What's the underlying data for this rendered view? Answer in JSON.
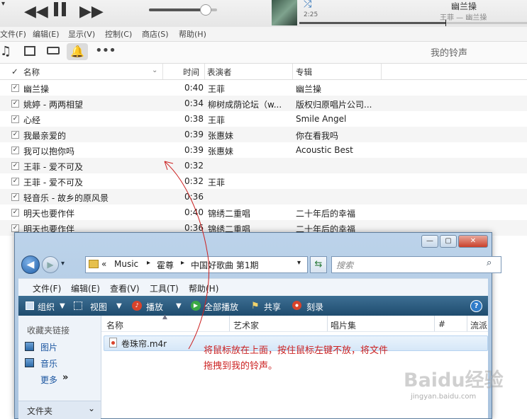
{
  "player": {
    "now_playing_title": "幽兰操",
    "now_playing_sub": "王菲 — 幽兰操",
    "elapsed": "2:25",
    "volume_level": 0.82
  },
  "menubar": {
    "items": [
      "文件(F)",
      "编辑(E)",
      "显示(V)",
      "控制(C)",
      "商店(S)",
      "帮助(H)"
    ]
  },
  "toolbar": {
    "title": "我的铃声"
  },
  "table": {
    "headers": {
      "name": "名称",
      "time": "时间",
      "artist": "表演者",
      "album": "专辑"
    },
    "rows": [
      {
        "name": "幽兰操",
        "time": "0:40",
        "artist": "王菲",
        "album": "幽兰操"
      },
      {
        "name": "姚婷 - 两两相望",
        "time": "0:34",
        "artist": "柳树成荫论坛（w...",
        "album": "版权归原唱片公司..."
      },
      {
        "name": "心经",
        "time": "0:38",
        "artist": "王菲",
        "album": "Smile Angel"
      },
      {
        "name": "我最亲爱的",
        "time": "0:39",
        "artist": "张惠妹",
        "album": "你在看我吗"
      },
      {
        "name": "我可以抱你吗",
        "time": "0:39",
        "artist": "张惠妹",
        "album": "Acoustic Best"
      },
      {
        "name": "王菲 - 爱不可及",
        "time": "0:32",
        "artist": "",
        "album": ""
      },
      {
        "name": "王菲 - 爱不可及",
        "time": "0:32",
        "artist": "王菲",
        "album": ""
      },
      {
        "name": "轻音乐 - 故乡的原风景",
        "time": "0:36",
        "artist": "",
        "album": ""
      },
      {
        "name": "明天也要作伴",
        "time": "0:40",
        "artist": "锦绣二重唱",
        "album": "二十年后的幸福"
      },
      {
        "name": "明天也要作伴",
        "time": "0:36",
        "artist": "锦绣二重唱",
        "album": "二十年后的幸福"
      }
    ]
  },
  "explorer": {
    "breadcrumb": [
      "Music",
      "霍尊",
      "中国好歌曲 第1期"
    ],
    "breadcrumb_prefix": "«",
    "search_placeholder": "搜索",
    "menu": [
      "文件(F)",
      "编辑(E)",
      "查看(V)",
      "工具(T)",
      "帮助(H)"
    ],
    "commands": {
      "organize": "组织",
      "views": "视图",
      "play": "播放",
      "play_all": "全部播放",
      "share": "共享",
      "burn": "刻录"
    },
    "nav": {
      "favorites": "收藏夹链接",
      "pictures": "图片",
      "music": "音乐",
      "more": "更多",
      "folders": "文件夹"
    },
    "columns": [
      "名称",
      "艺术家",
      "唱片集",
      "#",
      "流派"
    ],
    "file": "卷珠帘.m4r"
  },
  "annotation": {
    "line1": "将鼠标放在上面，按住鼠标左键不放，将文件",
    "line2": "拖拽到我的铃声。"
  },
  "watermark": {
    "brand": "Baidu经验",
    "url": "jingyan.baidu.com"
  },
  "colors": {
    "annotation_red": "#cc2222",
    "explorer_command_bar": "#2b5a7e",
    "selection_blue": "#d8e8f8"
  }
}
